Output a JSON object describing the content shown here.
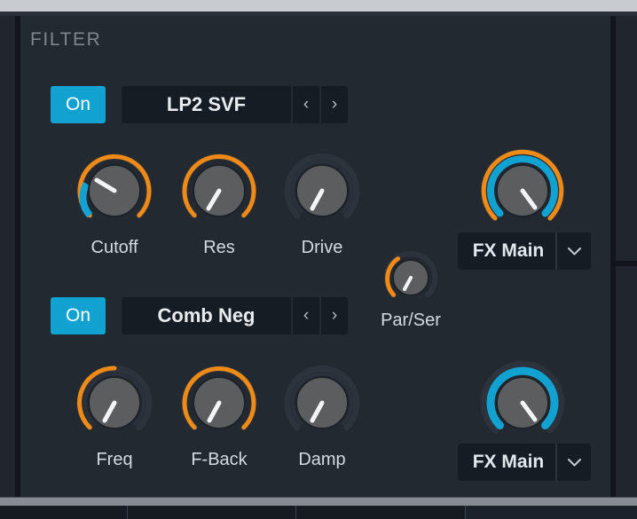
{
  "panel": {
    "title": "FILTER"
  },
  "filters": [
    {
      "id": "filter-1",
      "power_label": "On",
      "power_state": "on",
      "type_name": "LP2 SVF",
      "prev_arrow": "‹",
      "next_arrow": "›",
      "knobs": [
        {
          "id": "cutoff",
          "label": "Cutoff",
          "value": 0.56,
          "mod_start": 0.3,
          "mod_end": 0.56,
          "ring": "full",
          "arc_color": "#f08a16",
          "mod_color": "#11a2d2"
        },
        {
          "id": "res",
          "label": "Res",
          "value": 0.22,
          "ring": "full",
          "arc_color": "#f08a16"
        },
        {
          "id": "drive",
          "label": "Drive",
          "value": 0.2,
          "ring": "none",
          "arc_color": "#f08a16"
        }
      ],
      "destination": {
        "label": "FX Main",
        "caret": "⌄"
      },
      "dest_knob": {
        "id": "fx-main-1",
        "value": 0.62,
        "ring": "full",
        "arc_color": "#f08a16",
        "mod_color": "#11a2d2",
        "double_ring": true
      }
    },
    {
      "id": "filter-2",
      "power_label": "On",
      "power_state": "on",
      "type_name": "Comb Neg",
      "prev_arrow": "‹",
      "next_arrow": "›",
      "knobs": [
        {
          "id": "freq",
          "label": "Freq",
          "value": 0.48,
          "ring": "partial",
          "arc_color": "#f08a16"
        },
        {
          "id": "f-back",
          "label": "F-Back",
          "value": 0.26,
          "ring": "full",
          "arc_color": "#f08a16"
        },
        {
          "id": "damp",
          "label": "Damp",
          "value": 0.22,
          "ring": "none",
          "arc_color": "#f08a16"
        }
      ],
      "destination": {
        "label": "FX Main",
        "caret": "⌄"
      },
      "dest_knob": {
        "id": "fx-main-2",
        "value": 0.62,
        "ring": "full",
        "arc_color": "#11a2d2",
        "double_ring": false
      }
    }
  ],
  "routing_knob": {
    "id": "par-ser",
    "label": "Par/Ser",
    "value": 0.22,
    "ring": "partial",
    "arc_color": "#f08a16"
  },
  "colors": {
    "panel_bg": "#232931",
    "frame_bg": "#21262e",
    "accent_cyan": "#11a2d2",
    "accent_orange": "#f08a16",
    "knob_face": "#5a5c5e",
    "text_primary": "#e3e8ec",
    "text_dim": "#7d868f"
  }
}
